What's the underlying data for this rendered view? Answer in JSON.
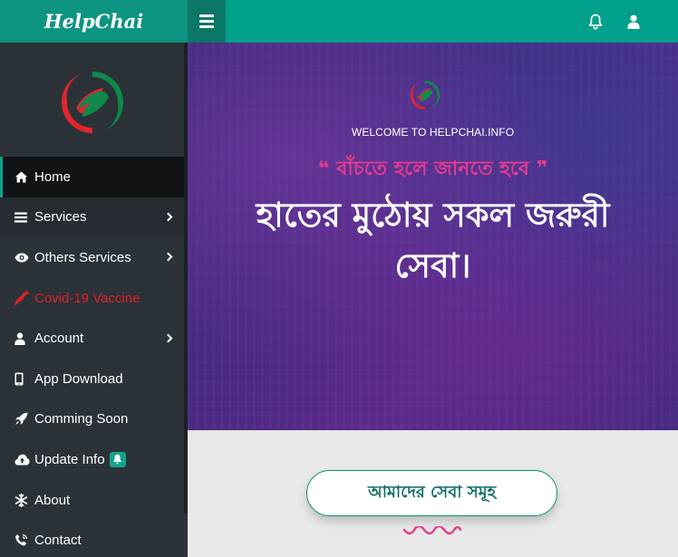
{
  "header": {
    "brand": "HelpChai",
    "menu_toggle_icon": "hamburger-icon",
    "notification_icon": "bell-icon",
    "user_icon": "user-icon"
  },
  "sidebar": {
    "logo_icon": "helpchai-logo",
    "items": [
      {
        "label": "Home",
        "icon": "home-icon",
        "active": true
      },
      {
        "label": "Services",
        "icon": "bars-icon",
        "submenu": true
      },
      {
        "label": "Others Services",
        "icon": "eye-icon",
        "submenu": true
      },
      {
        "label": "Covid-19 Vaccine",
        "icon": "syringe-icon",
        "color": "#e0212d"
      },
      {
        "label": "Account",
        "icon": "user-icon",
        "submenu": true
      },
      {
        "label": "App Download",
        "icon": "mobile-icon"
      },
      {
        "label": "Comming Soon",
        "icon": "rocket-icon"
      },
      {
        "label": "Update Info",
        "icon": "cloud-upload-icon",
        "badge_icon": "bell-icon"
      },
      {
        "label": "About",
        "icon": "snowflake-icon"
      },
      {
        "label": "Contact",
        "icon": "phone-icon"
      }
    ]
  },
  "hero": {
    "welcome": "WELCOME TO HELPCHAI.INFO",
    "tagline": "❝ বাঁচতে হলে জানতে হবে ❞",
    "headline_line1": "হাতের মুঠোয় সকল জরুরী",
    "headline_line2": "সেবা।"
  },
  "services_button": "আমাদের সেবা সমূহ",
  "colors": {
    "topbar": "#00a08a",
    "brand_bg": "#0c9480",
    "sidebar": "#2b3238",
    "accent": "#0aa38b",
    "tagline": "#e53b8f",
    "covid": "#e0212d"
  }
}
